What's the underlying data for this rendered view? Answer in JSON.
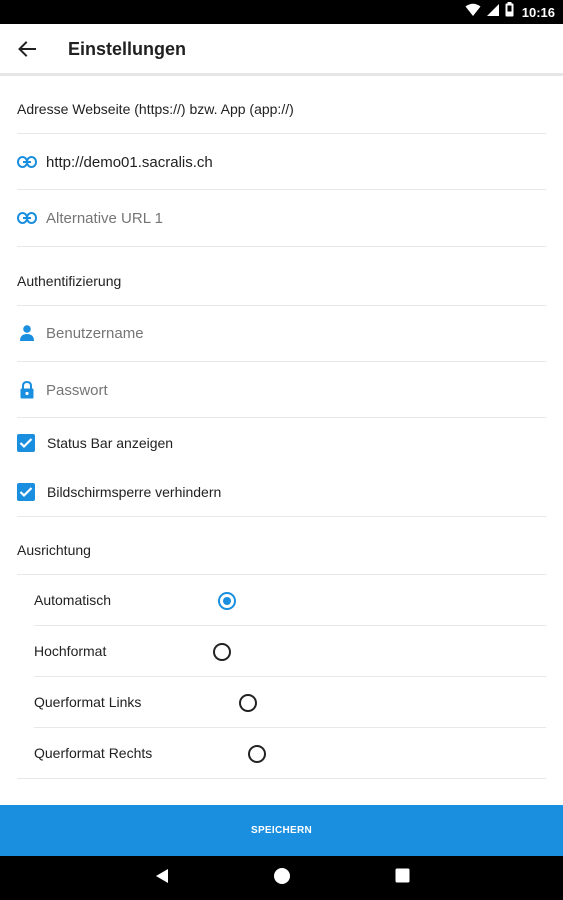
{
  "status_bar": {
    "time": "10:16",
    "icons": [
      "wifi-icon",
      "signal-icon",
      "battery-icon"
    ]
  },
  "app_bar": {
    "title": "Einstellungen",
    "back_icon": "arrow-back-icon"
  },
  "website": {
    "section_label": "Adresse Webseite (https://) bzw. App (app://)",
    "url_value": "http://demo01.sacralis.ch",
    "alt_url_placeholder": "Alternative URL 1",
    "link_icon": "link-icon"
  },
  "auth": {
    "section_label": "Authentifizierung",
    "username_placeholder": "Benutzername",
    "password_placeholder": "Passwort",
    "user_icon": "person-icon",
    "lock_icon": "lock-icon"
  },
  "options": {
    "status_bar_label": "Status Bar anzeigen",
    "status_bar_checked": true,
    "screen_lock_label": "Bildschirmsperre verhindern",
    "screen_lock_checked": true
  },
  "orientation": {
    "section_label": "Ausrichtung",
    "options": [
      {
        "label": "Automatisch",
        "selected": true
      },
      {
        "label": "Hochformat",
        "selected": false
      },
      {
        "label": "Querformat Links",
        "selected": false
      },
      {
        "label": "Querformat Rechts",
        "selected": false
      }
    ]
  },
  "save_button": {
    "label": "SPEICHERN"
  },
  "colors": {
    "accent": "#1a8fe0",
    "status_bar": "#000000",
    "nav_bar": "#000000"
  },
  "nav_bar": {
    "icons": [
      "back-triangle-icon",
      "home-circle-icon",
      "recents-square-icon"
    ]
  }
}
